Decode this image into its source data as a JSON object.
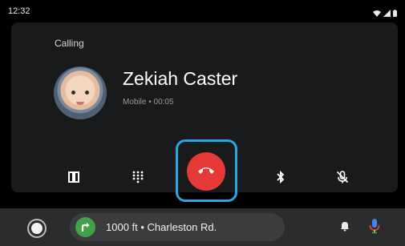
{
  "status_bar": {
    "time": "12:32",
    "icons": [
      "wifi-icon",
      "signal-icon",
      "battery-icon"
    ]
  },
  "call": {
    "status": "Calling",
    "contact_name": "Zekiah Caster",
    "meta": "Mobile • 00:05"
  },
  "controls": [
    {
      "icon": "pause-icon"
    },
    {
      "icon": "dialpad-icon"
    },
    {
      "icon": "end-call-icon"
    },
    {
      "icon": "bluetooth-icon"
    },
    {
      "icon": "mic-muted-icon"
    }
  ],
  "navigation": {
    "direction_icon": "turn-right-icon",
    "instruction": "1000 ft • Charleston Rd."
  },
  "colors": {
    "end_call": "#e53935",
    "highlight": "#29a7e1",
    "nav_turn": "#43a047",
    "mic_accent": "#4285f4"
  }
}
